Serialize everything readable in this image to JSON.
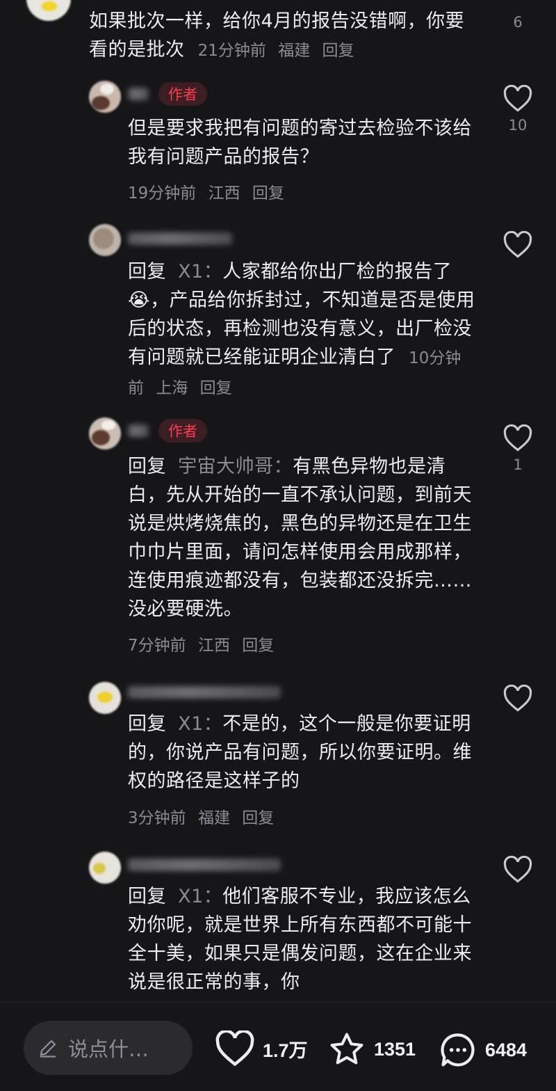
{
  "comments": [
    {
      "text": "如果批次一样，给你4月的报告没错啊，你要看的是批次",
      "time": "21分钟前",
      "location": "福建",
      "reply_label": "回复",
      "likes": "6"
    },
    {
      "author_badge": "作者",
      "text": "但是要求我把有问题的寄过去检验不该给我有问题产品的报告？",
      "time": "19分钟前",
      "location": "江西",
      "reply_label": "回复",
      "likes": "10"
    },
    {
      "reply_prefix": "回复",
      "reply_to": "X1：",
      "text_a": "人家都给你出厂检的报告了",
      "emoji": "😭",
      "text_b": "，产品给你拆封过，不知道是否是使用后的状态，再检测也没有意义，出厂检没有问题就已经能证明企业清白了",
      "time": "10分钟前",
      "location": "上海",
      "reply_label": "回复",
      "likes": ""
    },
    {
      "author_badge": "作者",
      "reply_prefix": "回复",
      "reply_to": "宇宙大帅哥：",
      "text": "有黑色异物也是清白，先从开始的一直不承认问题，到前天说是烘烤烧焦的，黑色的异物还是在卫生巾巾片里面，请问怎样使用会用成那样，连使用痕迹都没有，包装都还没拆完……没必要硬洗。",
      "time": "7分钟前",
      "location": "江西",
      "reply_label": "回复",
      "likes": "1"
    },
    {
      "reply_prefix": "回复",
      "reply_to": "X1：",
      "text": "不是的，这个一般是你要证明的，你说产品有问题，所以你要证明。维权的路径是这样子的",
      "time": "3分钟前",
      "location": "福建",
      "reply_label": "回复",
      "likes": ""
    },
    {
      "reply_prefix": "回复",
      "reply_to": "X1：",
      "text": "他们客服不专业，我应该怎么劝你呢，就是世界上所有东西都不可能十全十美，如果只是偶发问题，这在企业来说是很正常的事，你",
      "likes": ""
    }
  ],
  "bottom_bar": {
    "input_placeholder": "说点什…",
    "like_count": "1.7万",
    "favorite_count": "1351",
    "comment_count": "6484"
  },
  "colors": {
    "background": "#161619",
    "author_badge_text": "#ff3b4f",
    "author_badge_bg": "#3a1e22",
    "meta_text": "#8b8c93"
  }
}
